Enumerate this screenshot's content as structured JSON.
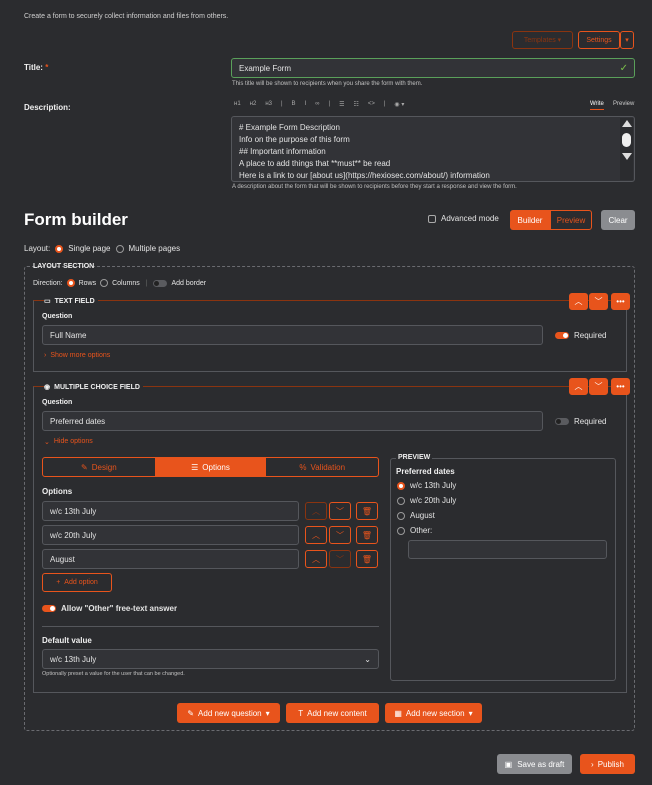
{
  "header": {
    "subtitle": "Create a form to securely collect information and files from others.",
    "templates_label": "Templates",
    "settings_label": "Settings"
  },
  "form": {
    "title_label": "Title:",
    "title_required_mark": "*",
    "title_value": "Example Form",
    "title_hint": "This title will be shown to recipients when you share the form with them.",
    "description_label": "Description:",
    "toolbar_items": [
      "H1",
      "H2",
      "H3",
      "B",
      "I",
      "link",
      "list",
      "list",
      "code",
      "eye"
    ],
    "write_tab": "Write",
    "preview_tab": "Preview",
    "description_lines": [
      "# Example Form Description",
      "Info on the purpose of this form",
      "## Important information",
      "A place to add things that **must** be read",
      "Here is a link to our [about us](https://hexiosec.com/about/) information"
    ],
    "description_hint": "A description about the form that will be shown to recipients before they start a response and view the form."
  },
  "builder": {
    "heading": "Form builder",
    "advanced_mode_label": "Advanced mode",
    "builder_label": "Builder",
    "preview_label": "Preview",
    "clear_label": "Clear",
    "layout_label": "Layout:",
    "single_page": "Single page",
    "multiple_pages": "Multiple pages"
  },
  "layout_section": {
    "heading": "LAYOUT SECTION",
    "direction_label": "Direction:",
    "rows_label": "Rows",
    "columns_label": "Columns",
    "add_border_label": "Add border"
  },
  "text_field": {
    "heading": "TEXT FIELD",
    "question_label": "Question",
    "question_value": "Full Name",
    "required_label": "Required",
    "show_more": "Show more options"
  },
  "multiple_choice": {
    "heading": "MULTIPLE CHOICE FIELD",
    "question_label": "Question",
    "question_value": "Preferred dates",
    "required_label": "Required",
    "hide_options": "Hide options",
    "tabs": {
      "design": "Design",
      "options": "Options",
      "validation": "Validation"
    },
    "options_label": "Options",
    "options": [
      "w/c 13th July",
      "w/c 20th July",
      "August"
    ],
    "add_option": "Add option",
    "allow_other": "Allow \"Other\" free-text answer",
    "default_value_label": "Default value",
    "default_value": "w/c 13th July",
    "default_hint": "Optionally preset a value for the user that can be changed.",
    "preview": {
      "heading": "PREVIEW",
      "question": "Preferred dates",
      "choices": [
        "w/c 13th July",
        "w/c 20th July",
        "August",
        "Other:"
      ]
    }
  },
  "actions": {
    "add_question": "Add new question",
    "add_content": "Add new content",
    "add_section": "Add new section"
  },
  "footer": {
    "save_draft": "Save as draft",
    "publish": "Publish"
  },
  "colors": {
    "accent": "#e8541c",
    "background": "#2b2c2f",
    "input_bg": "#323337"
  }
}
